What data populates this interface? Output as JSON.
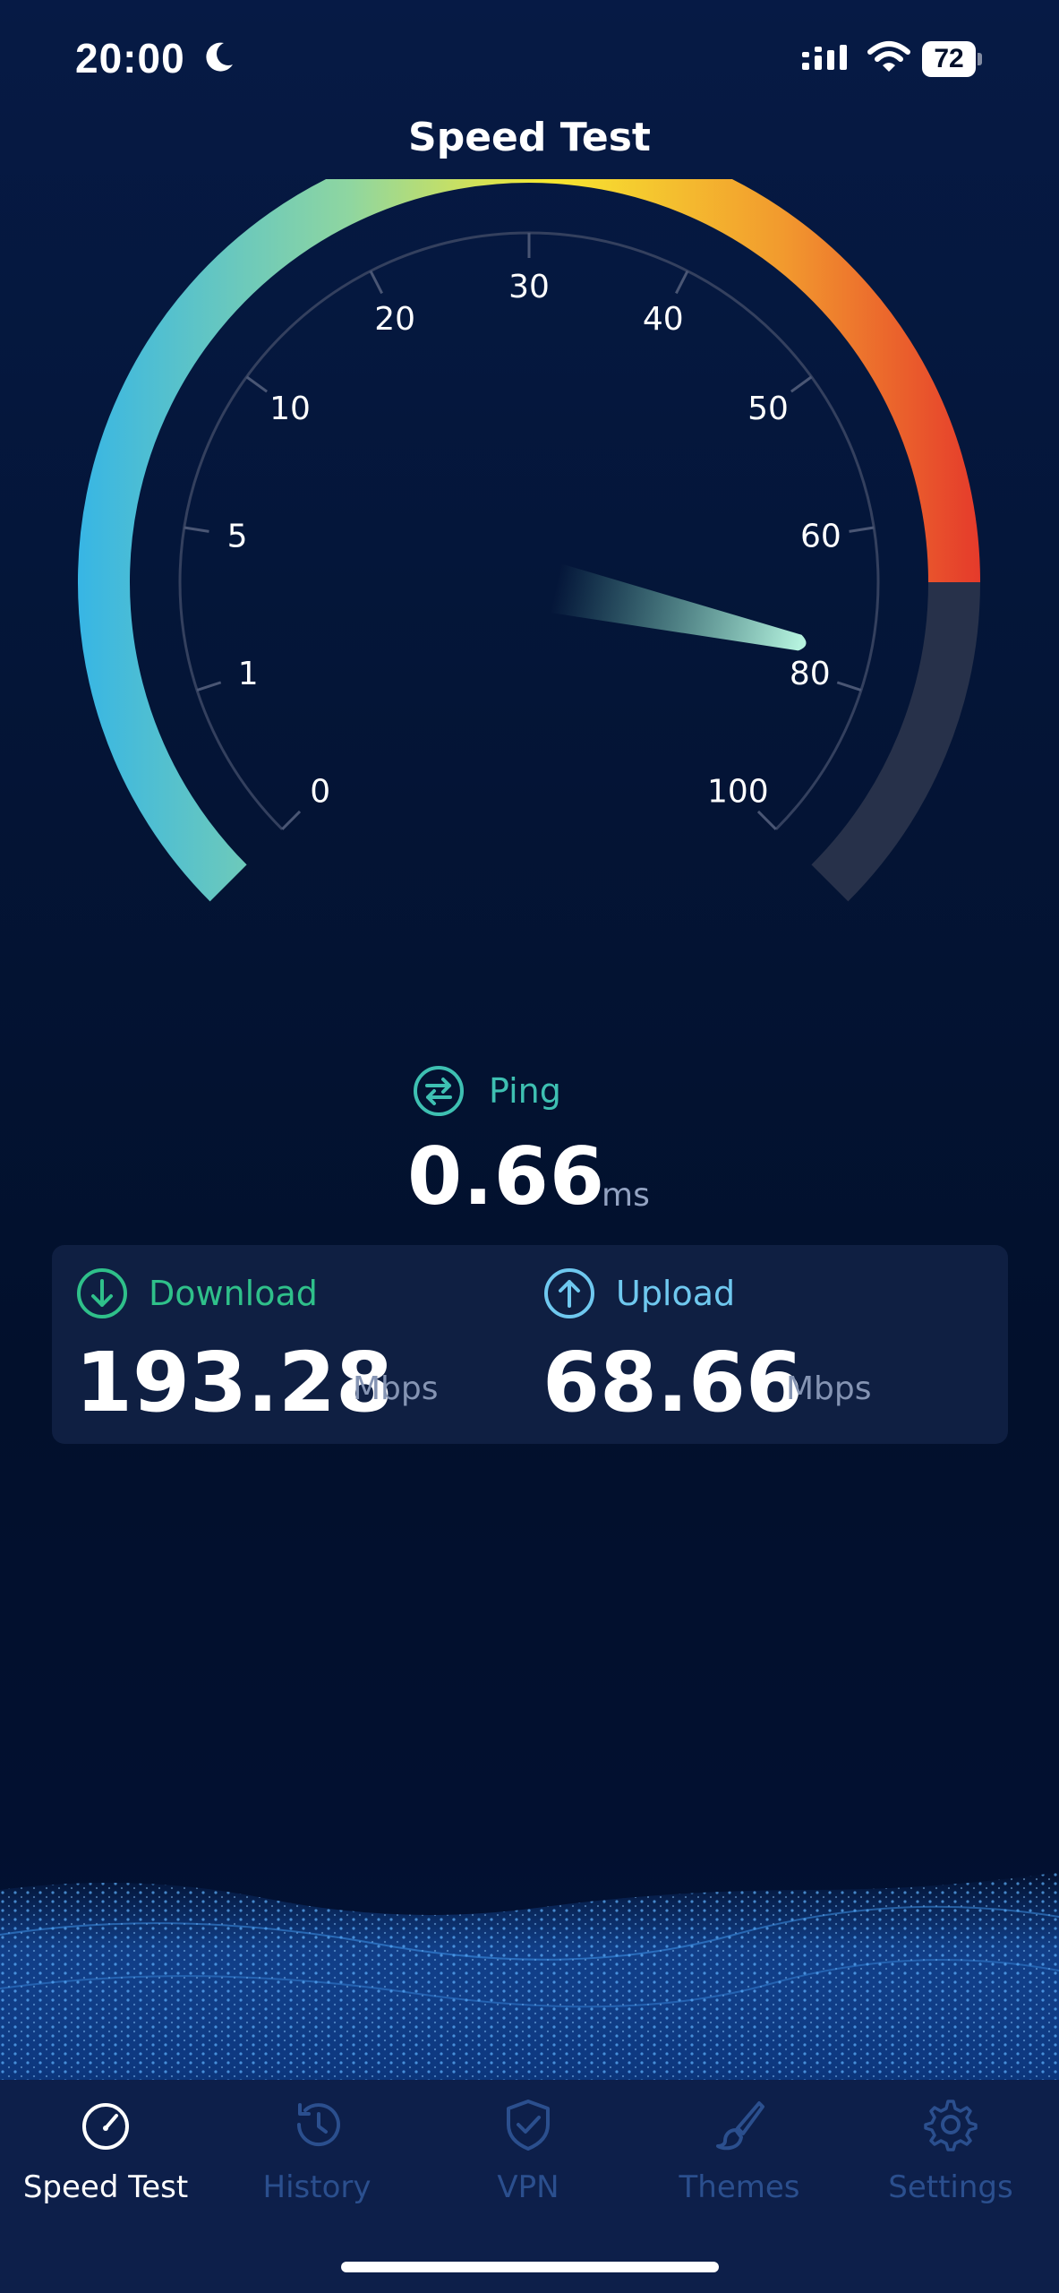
{
  "status_bar": {
    "time": "20:00",
    "battery": "72",
    "icons": [
      "moon-icon",
      "cellular-signal-icon",
      "wifi-icon",
      "battery-icon"
    ]
  },
  "page": {
    "title": "Speed Test"
  },
  "gauge": {
    "scale_labels": [
      "0",
      "1",
      "5",
      "10",
      "20",
      "30",
      "40",
      "50",
      "60",
      "80",
      "100"
    ],
    "needle_fraction": 0.88,
    "colors": {
      "gradient": [
        "#38b6e4",
        "#8fd6a0",
        "#f7e830",
        "#f29a2e",
        "#e53a2b"
      ],
      "unfilled": "#27314a",
      "needle": "#7be0c0"
    }
  },
  "ping": {
    "label": "Ping",
    "value": "0.66",
    "unit": "ms",
    "icon": "swap-arrows-icon"
  },
  "results": {
    "download": {
      "label": "Download",
      "value": "193.28",
      "unit": "Mbps",
      "icon": "download-arrow-icon",
      "color": "#2fc08a"
    },
    "upload": {
      "label": "Upload",
      "value": "68.66",
      "unit": "Mbps",
      "icon": "upload-arrow-icon",
      "color": "#6fc8ef"
    }
  },
  "tabs": [
    {
      "label": "Speed Test",
      "icon": "speedometer-icon",
      "active": true
    },
    {
      "label": "History",
      "icon": "history-icon",
      "active": false
    },
    {
      "label": "VPN",
      "icon": "shield-check-icon",
      "active": false
    },
    {
      "label": "Themes",
      "icon": "brush-icon",
      "active": false
    },
    {
      "label": "Settings",
      "icon": "gear-icon",
      "active": false
    }
  ]
}
